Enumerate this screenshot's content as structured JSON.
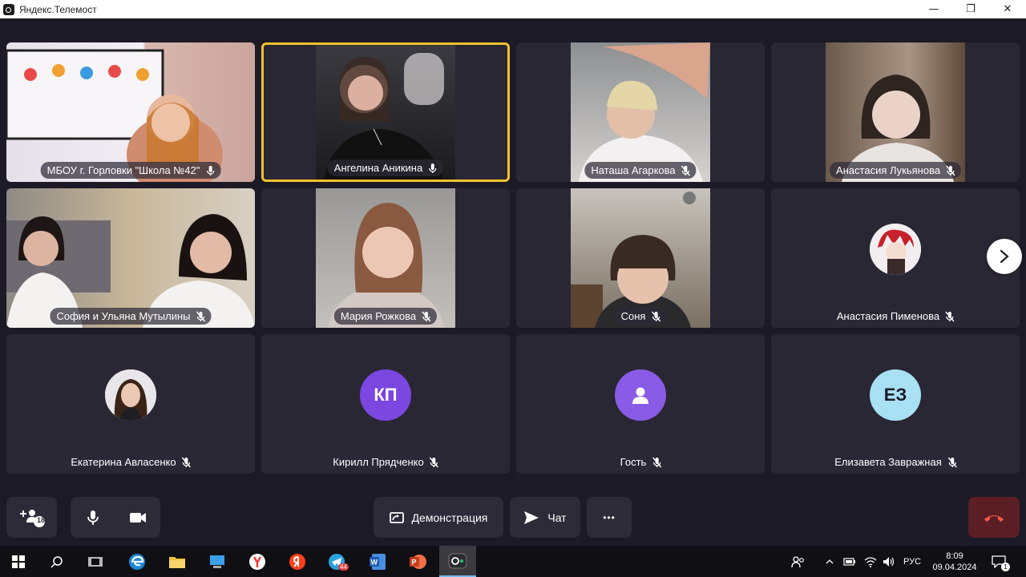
{
  "window": {
    "title": "Яндекс.Телемост",
    "minimize": "—",
    "restore": "❐",
    "close": "✕"
  },
  "participants": [
    {
      "name": "МБОУ г. Горловки \"Школа №42\"",
      "mic": "on",
      "type": "video",
      "active": false
    },
    {
      "name": "Ангелина Аникина",
      "mic": "on",
      "type": "video",
      "active": true
    },
    {
      "name": "Наташа Агаркова",
      "mic": "off",
      "type": "video",
      "active": false
    },
    {
      "name": "Анастасия Лукьянова",
      "mic": "off",
      "type": "video",
      "active": false
    },
    {
      "name": "София и Ульяна Мутылины",
      "mic": "off",
      "type": "video",
      "active": false
    },
    {
      "name": "Мария Рожкова",
      "mic": "off",
      "type": "video",
      "active": false
    },
    {
      "name": "Соня",
      "mic": "off",
      "type": "video",
      "active": false
    },
    {
      "name": "Анастасия Пименова",
      "mic": "off",
      "type": "photo-avatar",
      "active": false
    },
    {
      "name": "Екатерина Авласенко",
      "mic": "off",
      "type": "photo-avatar",
      "active": false
    },
    {
      "name": "Кирилл Прядченко",
      "mic": "off",
      "type": "initials",
      "initials": "КП",
      "avatar_color": "#7b47e0",
      "active": false
    },
    {
      "name": "Гость",
      "mic": "off",
      "type": "guest-icon",
      "avatar_color": "#8a5be6",
      "active": false
    },
    {
      "name": "Елизавета Завражная",
      "mic": "off",
      "type": "initials",
      "initials": "ЕЗ",
      "avatar_color": "#a8e0f4",
      "active": false
    }
  ],
  "controls": {
    "participants_count": "18",
    "demo_label": "Демонстрация",
    "chat_label": "Чат",
    "more_label": "•••"
  },
  "taskbar": {
    "language": "РУС",
    "time": "8:09",
    "date": "09.04.2024",
    "telegram_badge": "44",
    "notification_count": "1"
  },
  "colors": {
    "background": "#1d1a27",
    "tile": "#2a2734",
    "active_border": "#f2c12e",
    "hangup": "#5b1e25"
  }
}
